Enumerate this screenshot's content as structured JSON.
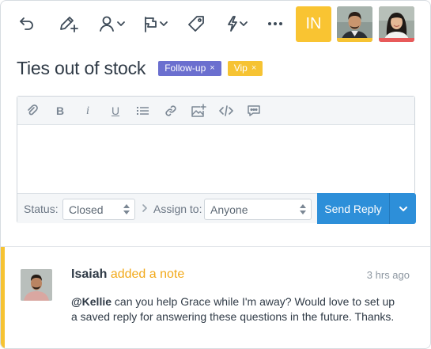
{
  "toolbar": {
    "icons": [
      "undo-icon",
      "edit-plus-icon",
      "user-dropdown-icon",
      "flag-dropdown-icon",
      "tag-icon",
      "lightning-dropdown-icon",
      "more-icon"
    ],
    "user_initials": "IN",
    "avatars": [
      {
        "name": "agent-avatar-man",
        "stripe_color": "#f6c333"
      },
      {
        "name": "agent-avatar-woman",
        "stripe_color": "#e85a5a"
      }
    ]
  },
  "conversation": {
    "title": "Ties out of stock",
    "tags": [
      {
        "label": "Follow-up",
        "color": "#6b6fcf"
      },
      {
        "label": "Vip",
        "color": "#f6c333"
      }
    ]
  },
  "editor": {
    "format_icons": [
      "attachment-icon",
      "bold-icon",
      "italic-icon",
      "underline-icon",
      "list-icon",
      "link-icon",
      "image-add-icon",
      "code-icon",
      "saved-reply-icon"
    ],
    "bold_glyph": "B",
    "italic_glyph": "i",
    "underline_glyph": "U",
    "status_label": "Status:",
    "status_value": "Closed",
    "assign_label": "Assign to:",
    "assign_value": "Anyone",
    "send_label": "Send Reply"
  },
  "note": {
    "author": "Isaiah",
    "action": "added a note",
    "time": "3 hrs ago",
    "mention": "@Kellie",
    "body": " can you help Grace while I'm away? Would love to set up a saved reply for answering these questions in the future. Thanks.",
    "accent_color": "#f6c333"
  },
  "colors": {
    "primary_button": "#2d8fd9",
    "initials_bg": "#f9c432"
  }
}
